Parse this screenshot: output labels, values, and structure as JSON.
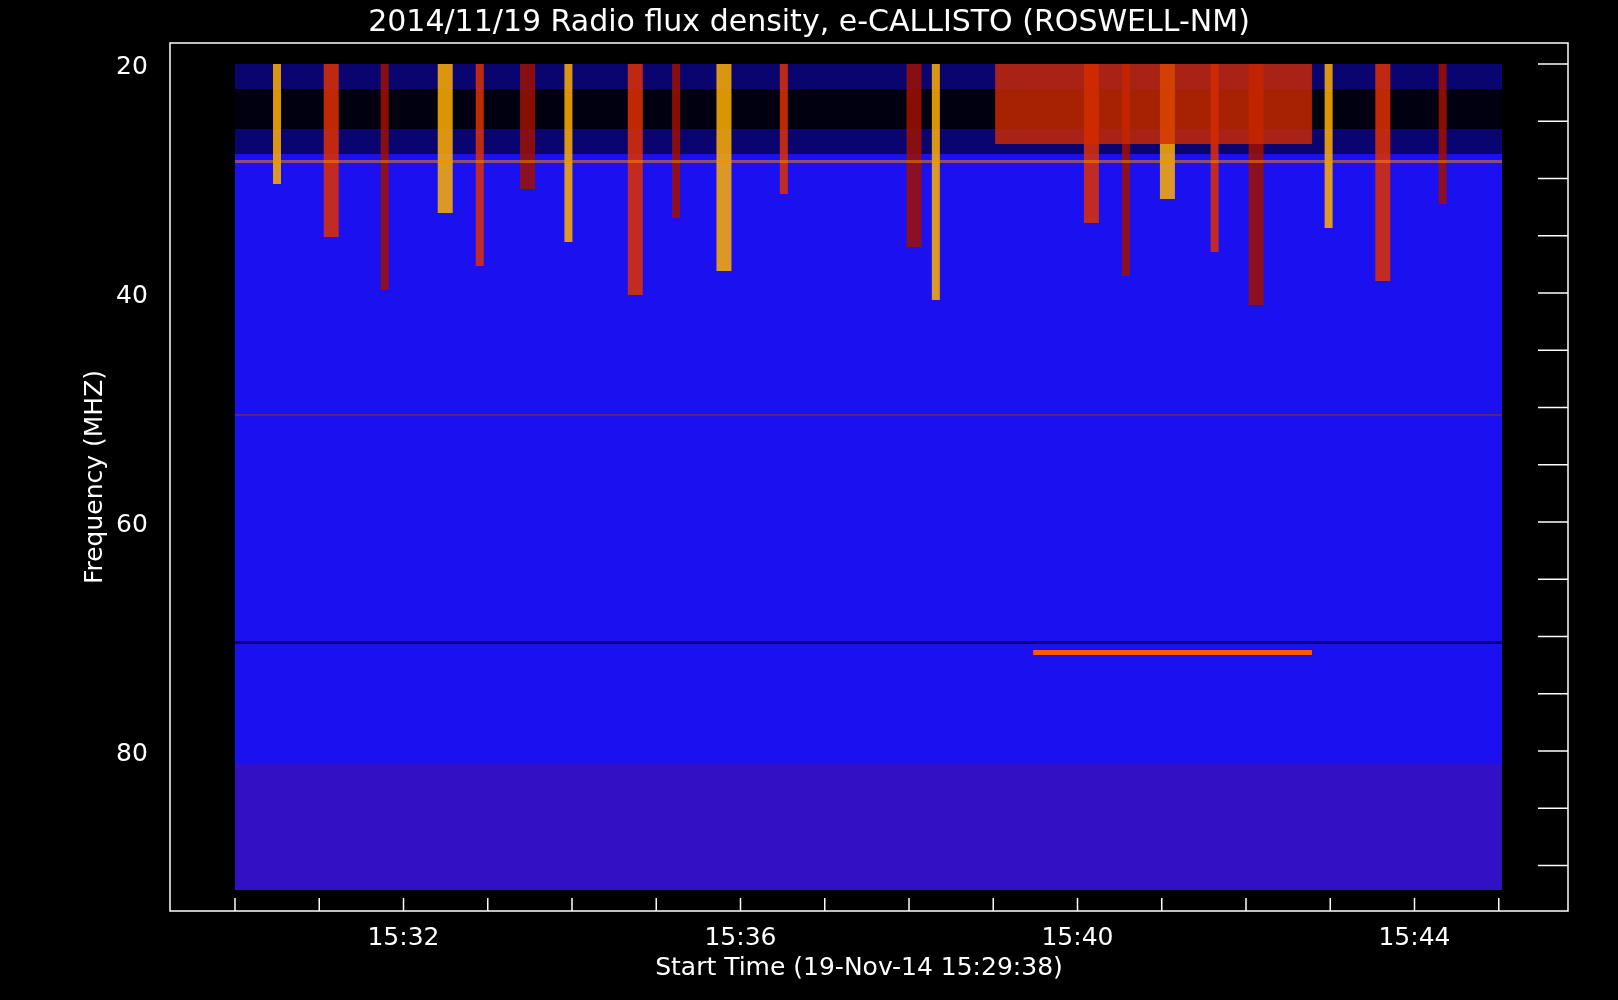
{
  "title": "2014/11/19  Radio flux density, e-CALLISTO (ROSWELL-NM)",
  "y_axis": {
    "label": "Frequency (MHZ)",
    "ticks": [
      "20",
      "40",
      "60",
      "80"
    ]
  },
  "x_axis": {
    "label": "Start Time (19-Nov-14 15:29:38)",
    "ticks": [
      "15:32",
      "15:36",
      "15:40",
      "15:44"
    ]
  }
}
